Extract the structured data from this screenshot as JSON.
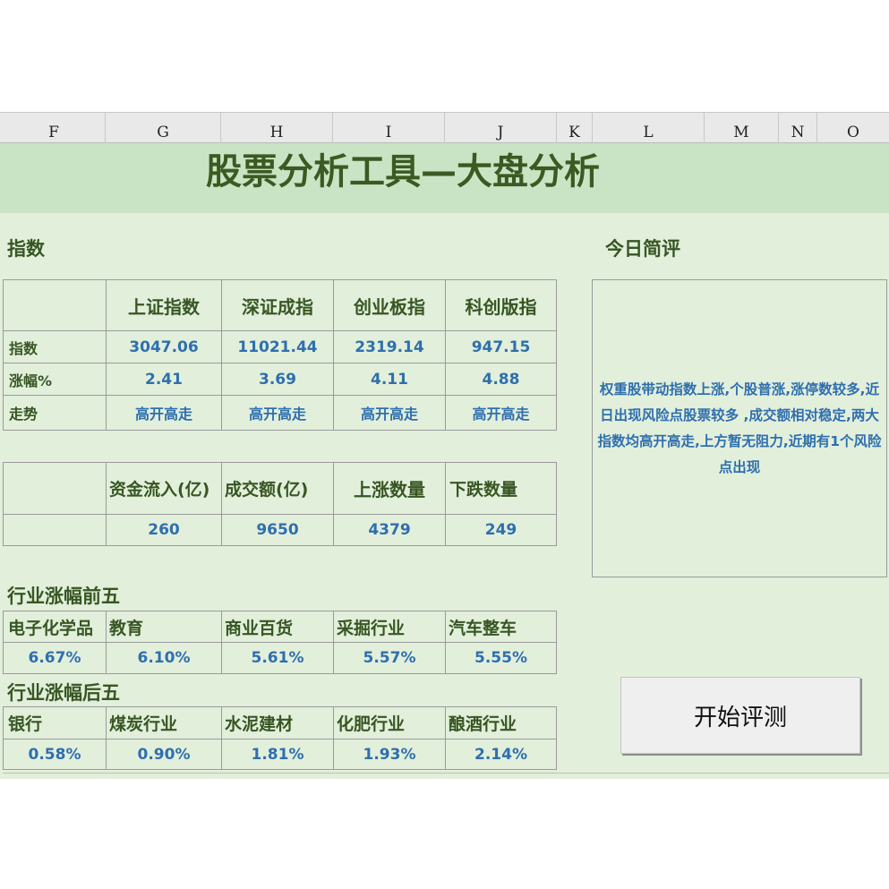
{
  "columns": [
    "F",
    "G",
    "H",
    "I",
    "J",
    "K",
    "L",
    "M",
    "N",
    "O"
  ],
  "title": "股票分析工具—大盘分析",
  "index_section": {
    "heading": "指数",
    "headers": [
      "上证指数",
      "深证成指",
      "创业板指",
      "科创版指"
    ],
    "rows": [
      {
        "label": "指数",
        "values": [
          "3047.06",
          "11021.44",
          "2319.14",
          "947.15"
        ]
      },
      {
        "label": "涨幅%",
        "values": [
          "2.41",
          "3.69",
          "4.11",
          "4.88"
        ]
      },
      {
        "label": "走势",
        "values": [
          "高开高走",
          "高开高走",
          "高开高走",
          "高开高走"
        ]
      }
    ]
  },
  "capital": {
    "headers": [
      "资金流入(亿)",
      "成交额(亿)",
      "上涨数量",
      "下跌数量"
    ],
    "values": [
      "260",
      "9650",
      "4379",
      "249"
    ]
  },
  "top5": {
    "heading": "行业涨幅前五",
    "names": [
      "电子化学品",
      "教育",
      "商业百货",
      "采掘行业",
      "汽车整车"
    ],
    "values": [
      "6.67%",
      "6.10%",
      "5.61%",
      "5.57%",
      "5.55%"
    ]
  },
  "bottom5": {
    "heading": "行业涨幅后五",
    "names": [
      "银行",
      "煤炭行业",
      "水泥建材",
      "化肥行业",
      "酿酒行业"
    ],
    "values": [
      "0.58%",
      "0.90%",
      "1.81%",
      "1.93%",
      "2.14%"
    ]
  },
  "review": {
    "heading": "今日简评",
    "text": "权重股带动指数上涨,个股普涨,涨停数较多,近日出现风险点股票较多 ,成交额相对稳定,两大指数均高开高走,上方暂无阻力,近期有1个风险点出现"
  },
  "button_label": "开始评测",
  "colors": {
    "title": "#3b5a22",
    "value": "#2f6fae",
    "band": "#c9e4c4",
    "sheet": "#e2efdb"
  }
}
